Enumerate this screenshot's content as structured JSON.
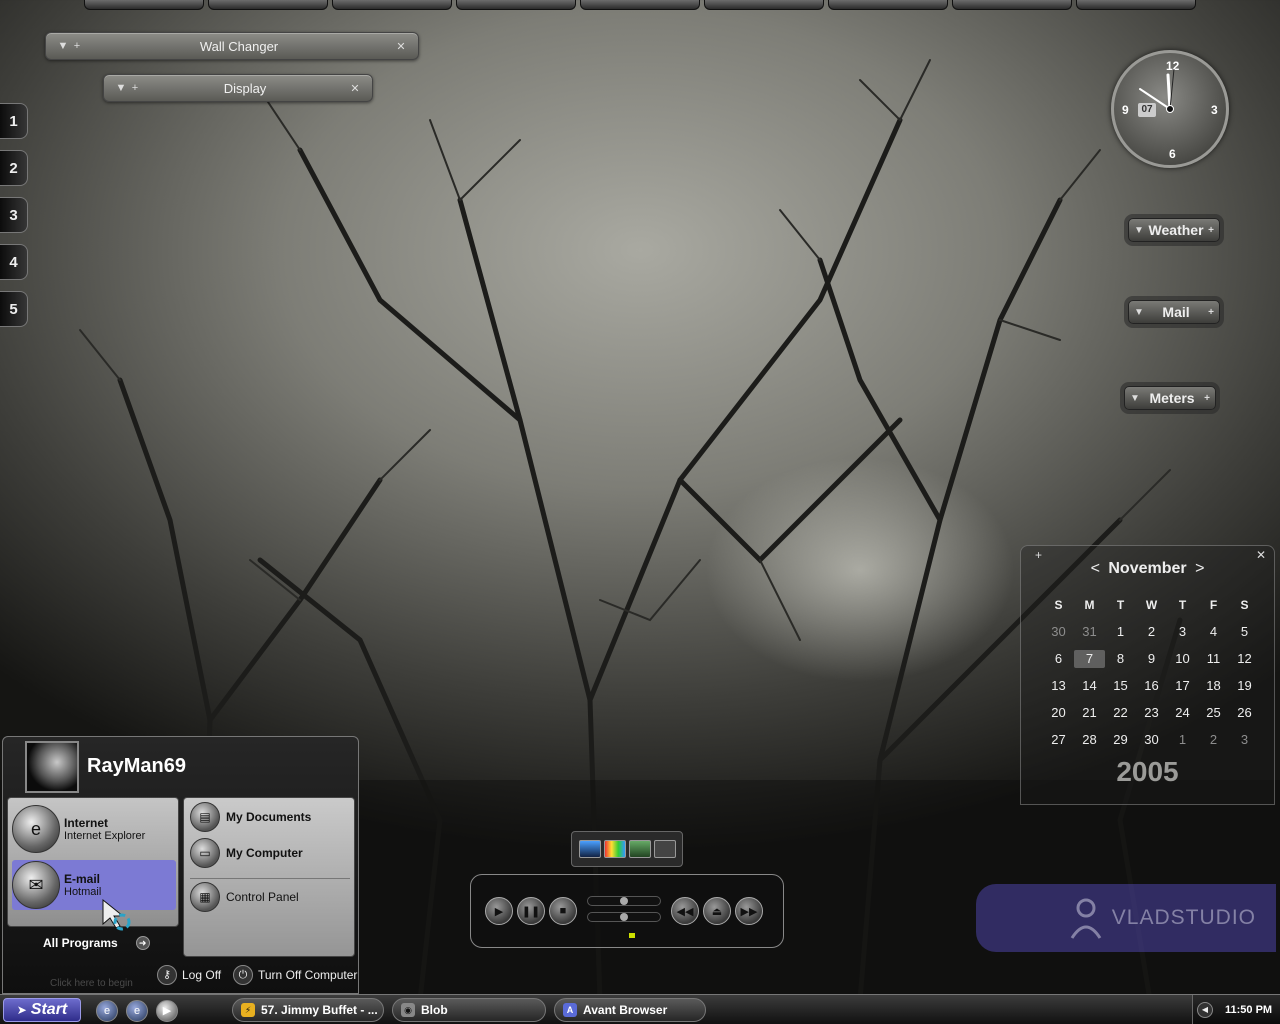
{
  "widgets": {
    "wall_changer": {
      "title": "Wall Changer"
    },
    "display": {
      "title": "Display"
    }
  },
  "virtual_desktops": [
    "1",
    "2",
    "3",
    "4",
    "5"
  ],
  "clock": {
    "numbers": {
      "twelve": "12",
      "three": "3",
      "six": "6",
      "nine": "9"
    },
    "date": "07",
    "time_shown": "11:50"
  },
  "side_widgets": {
    "weather": "Weather",
    "mail": "Mail",
    "meters": "Meters"
  },
  "calendar": {
    "month": "November",
    "prev": "<",
    "next": ">",
    "year": "2005",
    "days_of_week": [
      "S",
      "M",
      "T",
      "W",
      "T",
      "F",
      "S"
    ],
    "today": "7",
    "weeks": [
      [
        "30",
        "31",
        "1",
        "2",
        "3",
        "4",
        "5"
      ],
      [
        "6",
        "7",
        "8",
        "9",
        "10",
        "11",
        "12"
      ],
      [
        "13",
        "14",
        "15",
        "16",
        "17",
        "18",
        "19"
      ],
      [
        "20",
        "21",
        "22",
        "23",
        "24",
        "25",
        "26"
      ],
      [
        "27",
        "28",
        "29",
        "30",
        "1",
        "2",
        "3"
      ]
    ],
    "dim_cells": [
      [
        0,
        0
      ],
      [
        0,
        1
      ],
      [
        4,
        4
      ],
      [
        4,
        5
      ],
      [
        4,
        6
      ]
    ]
  },
  "watermark": "VLADSTUDIO",
  "start_menu": {
    "username": "RayMan69",
    "pinned": [
      {
        "title": "Internet",
        "subtitle": "Internet Explorer"
      },
      {
        "title": "E-mail",
        "subtitle": "Hotmail"
      }
    ],
    "places": [
      {
        "label": "My Documents"
      },
      {
        "label": "My Computer"
      },
      {
        "label": "Control Panel"
      }
    ],
    "all_programs": "All Programs",
    "log_off": "Log Off",
    "turn_off": "Turn Off Computer",
    "hint": "Click here to begin"
  },
  "taskbar": {
    "start_label": "Start",
    "tasks": [
      {
        "label": "57. Jimmy Buffet - ..."
      },
      {
        "label": "Blob"
      },
      {
        "label": "Avant Browser"
      }
    ],
    "clock": "11:50 PM"
  },
  "colors": {
    "start_button": "#4b49b3",
    "selected_item": "#7c7ad4",
    "watermark_bg": "#5a50c8"
  }
}
